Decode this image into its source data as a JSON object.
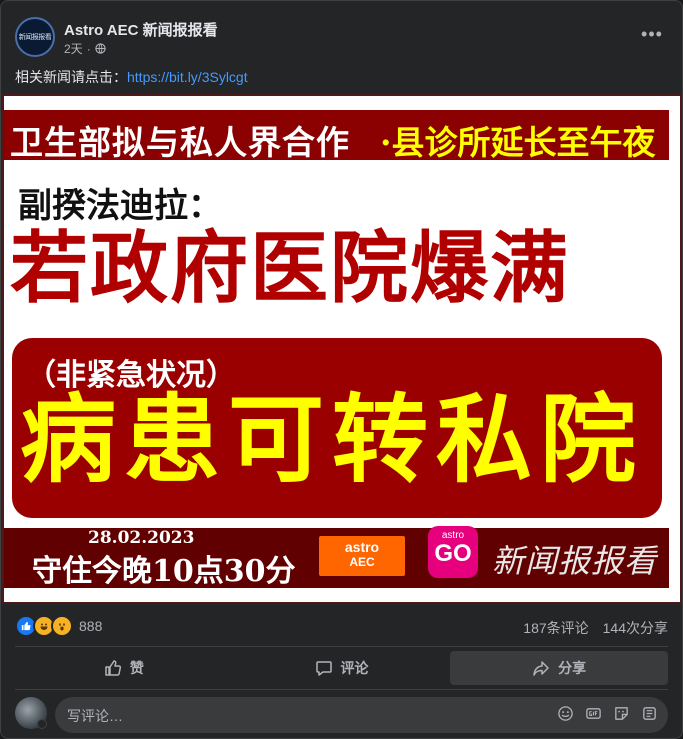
{
  "post": {
    "page_name": "Astro AEC 新闻报报看",
    "avatar_text": "新闻报报看",
    "time": "2天",
    "separator": "·",
    "text": "相关新闻请点击：",
    "link": "https://bit.ly/3Sylcgt",
    "more_label": "•••"
  },
  "image": {
    "headline_left": "卫生部拟与私人界合作",
    "headline_right": "·县诊所延长至午夜",
    "subhead": "副揆法迪拉：",
    "main_line": "若政府医院爆满",
    "paren_line": "（非紧急状况）",
    "big_line": "病患可转私院",
    "date": "28.02.2023",
    "tonight": "守住今晚10点30分",
    "logo_astro": "astro",
    "logo_aec": "AEC",
    "logo_go_top": "astro",
    "logo_go": "GO",
    "calligraphy": "新闻报报看"
  },
  "stats": {
    "reaction_icons": [
      "like-icon",
      "haha-icon",
      "wow-icon"
    ],
    "reaction_count": "888",
    "comments": "187条评论",
    "shares": "144次分享"
  },
  "actions": {
    "like": "赞",
    "comment": "评论",
    "share": "分享"
  },
  "composer": {
    "placeholder": "写评论…",
    "icons": [
      "emoji-icon",
      "gif-icon",
      "sticker-icon",
      "avatar-sticker-icon"
    ]
  },
  "colors": {
    "background": "#242526",
    "link": "#4599ff",
    "headline_red": "#b10000",
    "yellow": "#ffff00"
  }
}
